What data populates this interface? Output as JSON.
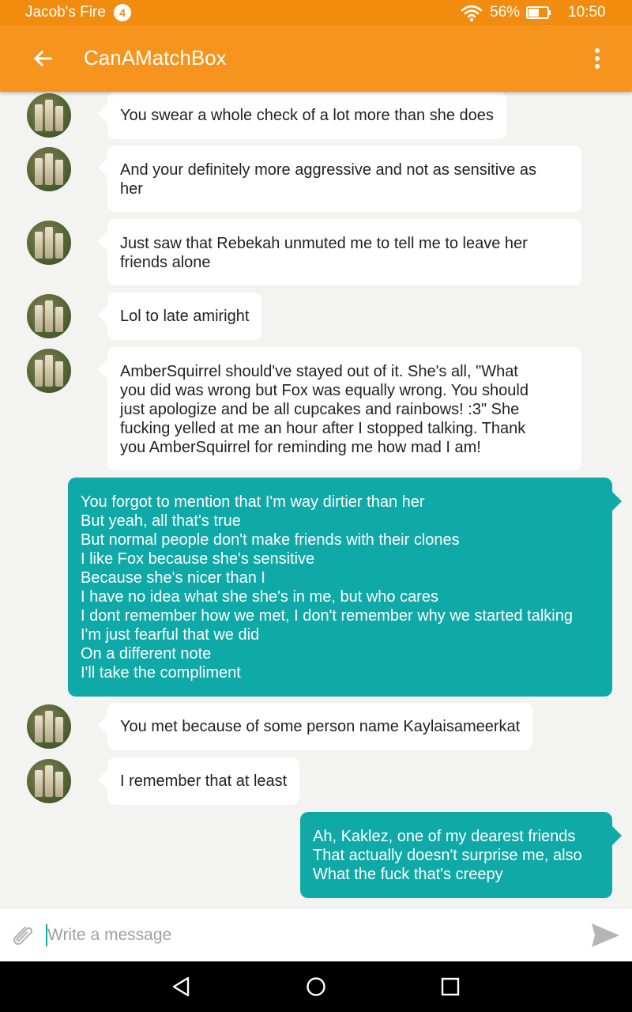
{
  "status_bar": {
    "carrier": "Jacob's Fire",
    "notification_count": "4",
    "battery_percent": "56%",
    "battery_level": 0.56,
    "time": "10:50"
  },
  "app_bar": {
    "title": "CanAMatchBox",
    "back_icon": "arrow-left-icon",
    "menu_icon": "more-vertical-icon"
  },
  "messages": [
    {
      "direction": "incoming",
      "lines": [
        "You swear a whole check of a lot more than she does"
      ]
    },
    {
      "direction": "incoming",
      "lines": [
        "And your definitely more aggressive and not as sensitive as",
        "her"
      ]
    },
    {
      "direction": "incoming",
      "lines": [
        "Just saw that Rebekah unmuted me to tell me to leave her",
        "friends alone"
      ]
    },
    {
      "direction": "incoming",
      "lines": [
        "Lol to late amiright"
      ]
    },
    {
      "direction": "incoming",
      "lines": [
        "AmberSquirrel should've stayed out of it. She's all, \"What",
        "you did was wrong but Fox was equally wrong. You should",
        "just apologize and be all cupcakes and rainbows! :3\" She",
        "fucking yelled at me an hour after I stopped talking. Thank",
        "you AmberSquirrel for reminding me how mad I am!"
      ]
    },
    {
      "direction": "outgoing",
      "lines": [
        "You forgot to mention that I'm way dirtier than her",
        "But yeah, all that's true",
        "But normal people don't make friends with their clones",
        "I like Fox because she's sensitive",
        "Because she's nicer than I",
        "I have no idea what she she's in me, but who cares",
        "I dont remember how we met, I don't remember why we started talking",
        "I'm just fearful that we did",
        "On a different note",
        "I'll take the compliment"
      ]
    },
    {
      "direction": "incoming",
      "lines": [
        "You met because of some person name Kaylaisameerkat"
      ]
    },
    {
      "direction": "incoming",
      "lines": [
        "I remember that at least"
      ]
    },
    {
      "direction": "outgoing",
      "lines": [
        "Ah, Kaklez, one of my dearest friends",
        "That actually doesn't surprise me, also",
        "What the fuck that's creepy"
      ]
    }
  ],
  "composer": {
    "placeholder": "Write a message",
    "value": "",
    "attach_icon": "paperclip-icon",
    "send_icon": "send-icon"
  },
  "nav_bar": {
    "back_icon": "triangle-back-icon",
    "home_icon": "circle-home-icon",
    "recents_icon": "square-recents-icon"
  },
  "colors": {
    "status_bar": "#f28c0f",
    "app_bar": "#f7941d",
    "outgoing_bubble": "#0fa9a7",
    "incoming_bubble": "#ffffff",
    "background": "#f3f3f1"
  }
}
